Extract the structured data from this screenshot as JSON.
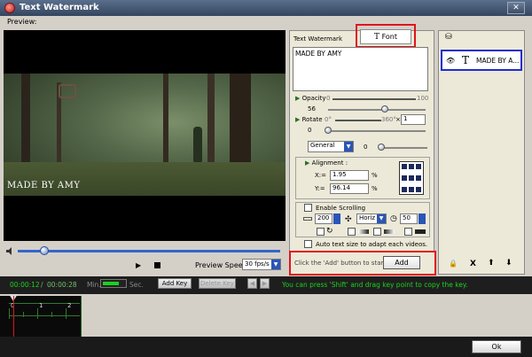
{
  "window": {
    "title": "Text Watermark",
    "close_glyph": "✕"
  },
  "preview": {
    "label": "Preview:",
    "watermark_overlay": "MADE BY AMY",
    "play_glyph": "▶",
    "speed_label": "Preview Speed:",
    "speed_value": "30 fps/s",
    "seek_progress": 0.1
  },
  "tabs": {
    "text_watermark": "Text Watermark",
    "font": "Font",
    "font_glyph": "T"
  },
  "text_content": "MADE BY AMY",
  "opacity": {
    "label": "Opacity",
    "min": "0",
    "max": "100",
    "value": "56"
  },
  "rotate": {
    "label": "Rotate",
    "min": "0°",
    "max": "360°",
    "multiplier_symbol": "×",
    "multiplier": "1",
    "value": "0"
  },
  "general": {
    "select": "General",
    "value": "0"
  },
  "alignment": {
    "label": "Alignment :",
    "x_label": "X:=",
    "x_value": "1.95",
    "y_label": "Y:=",
    "y_value": "96.14",
    "unit": "%"
  },
  "scrolling": {
    "label": "Enable Scrolling",
    "speed": "200",
    "direction": "Horiz",
    "duration": "50"
  },
  "auto_size_label": "Auto text size to adapt each videos.",
  "status": {
    "hint": "Click the 'Add' button to start ->",
    "add_label": "Add"
  },
  "layers": {
    "header_glyph": "⛁",
    "items": [
      {
        "glyph": "T",
        "label": "MADE BY A...",
        "eye": "👁"
      }
    ],
    "actions": [
      "🔒",
      "X",
      "⬆",
      "⬇"
    ]
  },
  "timeline": {
    "current": "00:00:12",
    "total": "00:00:28",
    "min_label": "Min.",
    "sec_label": "Sec.",
    "add_key": "Add Key",
    "delete_key": "Delete Key",
    "hint": "You can press 'Shift' and drag key point to copy the key.",
    "ruler_labels": [
      "0",
      "1",
      "2"
    ]
  },
  "ok_label": "Ok"
}
